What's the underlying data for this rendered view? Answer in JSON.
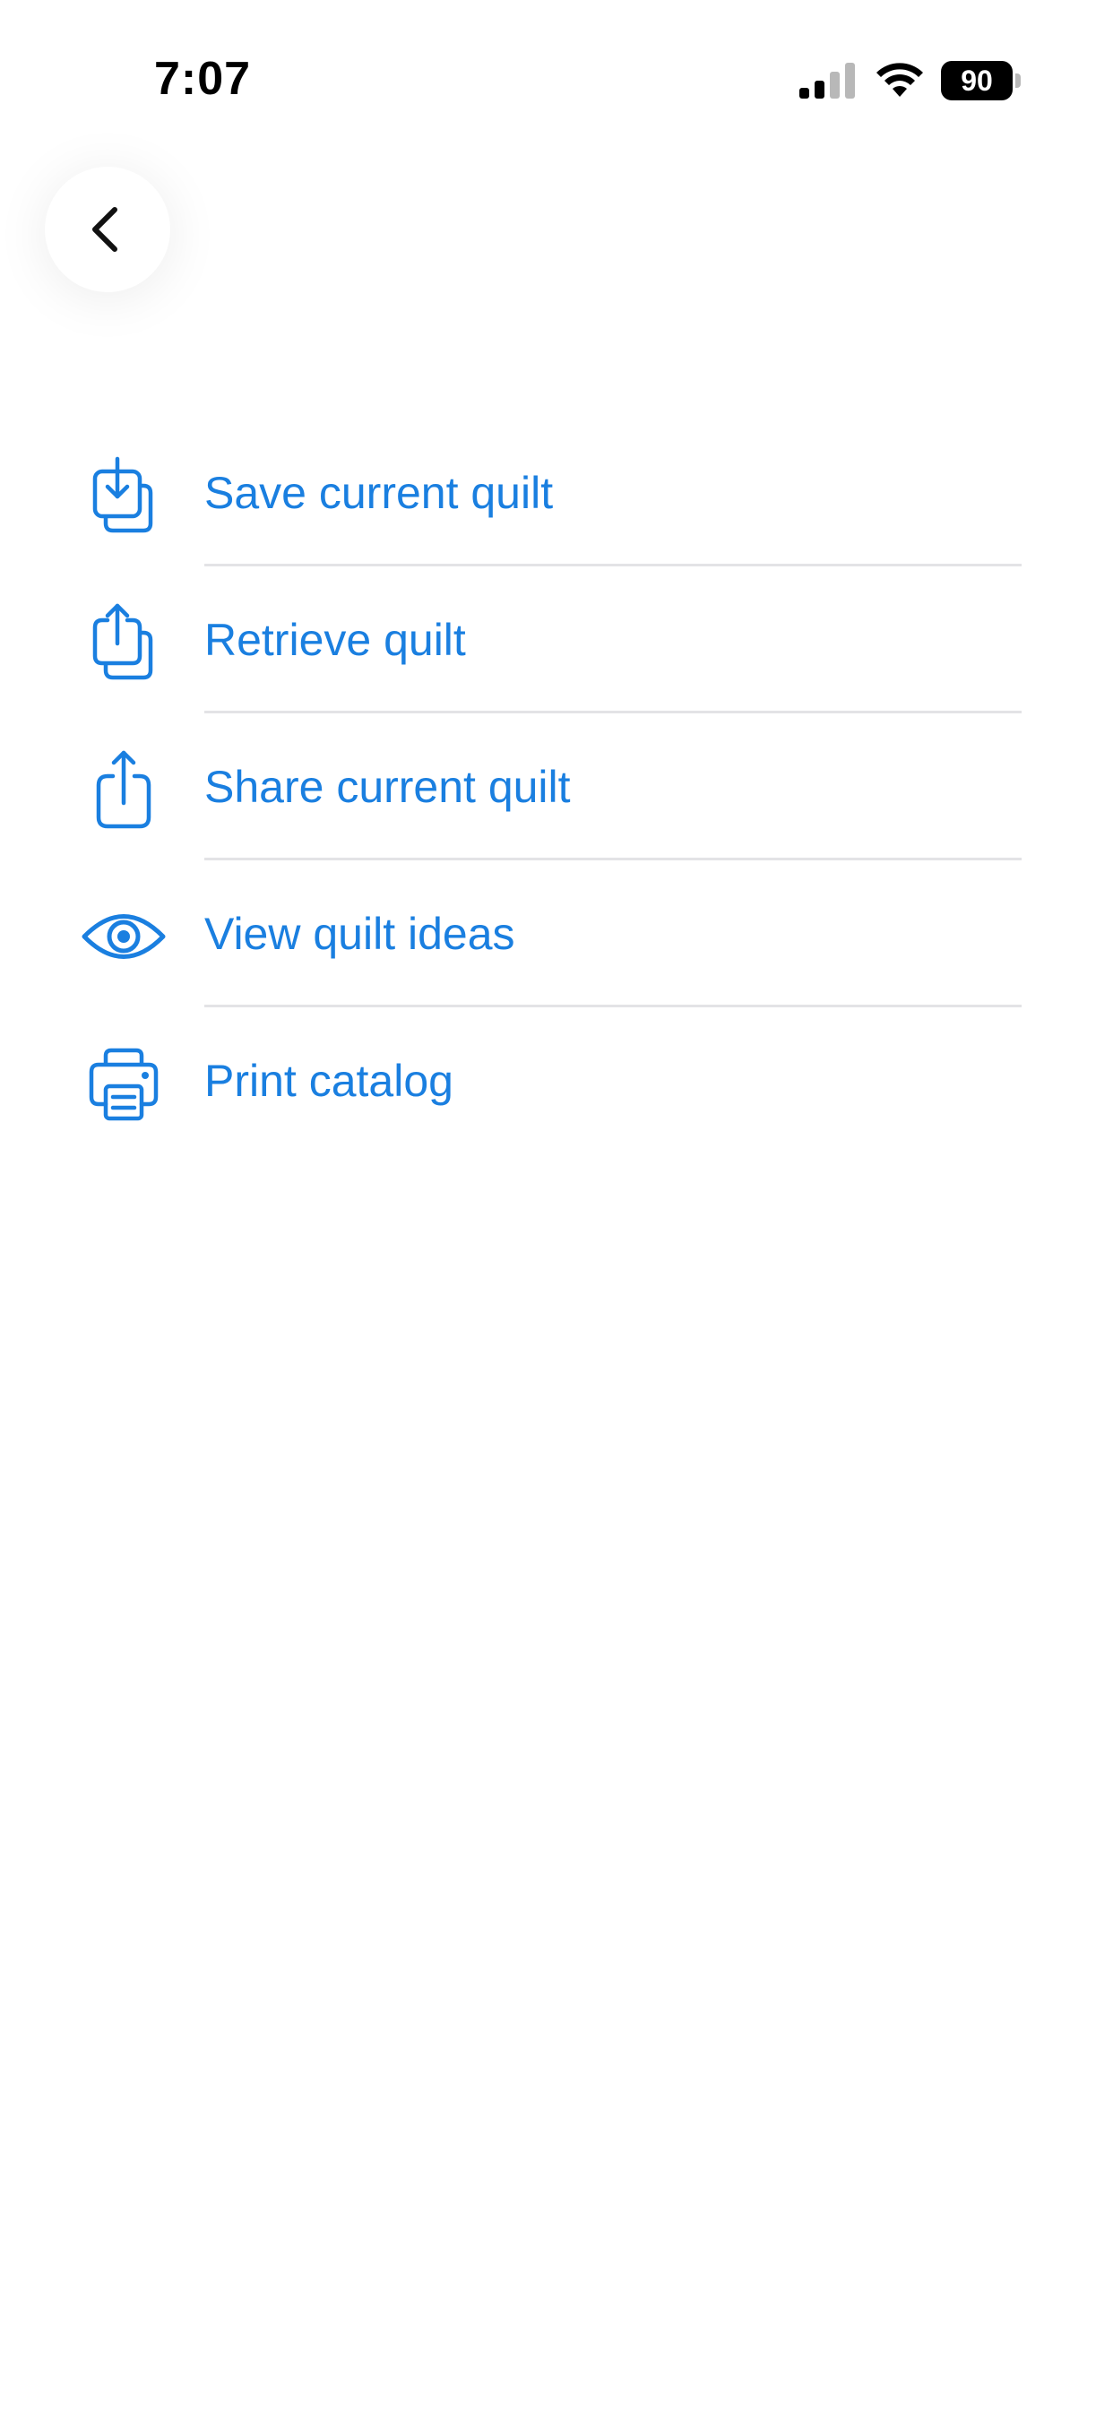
{
  "status_bar": {
    "time": "7:07",
    "battery": "90",
    "signal_icon": "cellular-signal-icon",
    "wifi_icon": "wifi-icon",
    "battery_icon": "battery-icon"
  },
  "header": {
    "back_icon": "chevron-left-icon"
  },
  "colors": {
    "accent": "#1a7fe0",
    "divider": "#e3e3e6",
    "background": "#ffffff"
  },
  "menu": {
    "items": [
      {
        "label": "Save current quilt",
        "icon": "save-download-icon"
      },
      {
        "label": "Retrieve quilt",
        "icon": "retrieve-upload-icon"
      },
      {
        "label": "Share current quilt",
        "icon": "share-icon"
      },
      {
        "label": "View quilt ideas",
        "icon": "eye-icon"
      },
      {
        "label": "Print catalog",
        "icon": "printer-icon"
      }
    ]
  }
}
